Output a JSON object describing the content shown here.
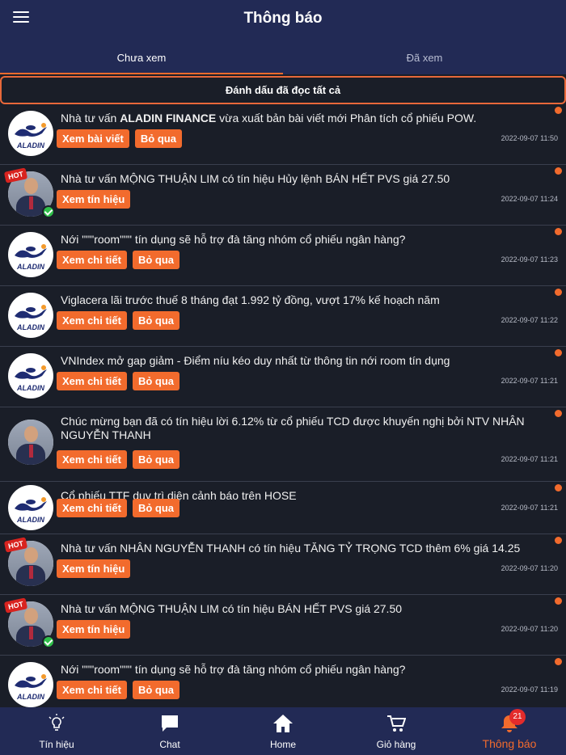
{
  "header": {
    "title": "Thông báo"
  },
  "tabs": [
    {
      "label": "Chưa xem"
    },
    {
      "label": "Đã xem"
    }
  ],
  "mark_all_read": "Đánh dấu đã đọc tất cả",
  "notifications": [
    {
      "prefix": "Nhà tư vấn ",
      "bold": "ALADIN FINANCE",
      "suffix": " vừa xuất bản bài viết mới Phân tích cổ phiếu POW.",
      "actions": [
        "Xem bài viết",
        "Bỏ qua"
      ],
      "time": "2022-09-07 11:50",
      "avatar": "aladin-logo"
    },
    {
      "text": "Nhà tư vấn MỘNG THUẬN LIM có tín hiệu Hủy lệnh BÁN HẾT PVS giá 27.50",
      "actions": [
        "Xem tín hiệu"
      ],
      "time": "2022-09-07 11:24",
      "avatar": "person",
      "hot": "HOT"
    },
    {
      "text": "Nới \"\"\"room\"\"\" tín dụng sẽ hỗ trợ đà tăng nhóm cổ phiếu ngân hàng?",
      "actions": [
        "Xem chi tiết",
        "Bỏ qua"
      ],
      "time": "2022-09-07 11:23",
      "avatar": "aladin-logo"
    },
    {
      "text": "Viglacera lãi trước thuế 8 tháng đạt 1.992 tỷ đồng, vượt 17% kế hoạch năm",
      "actions": [
        "Xem chi tiết",
        "Bỏ qua"
      ],
      "time": "2022-09-07 11:22",
      "avatar": "aladin-logo"
    },
    {
      "text": "VNIndex mở gap giảm - Điểm níu kéo duy nhất từ thông tin nới room tín dụng",
      "actions": [
        "Xem chi tiết",
        "Bỏ qua"
      ],
      "time": "2022-09-07 11:21",
      "avatar": "aladin-logo"
    },
    {
      "text": "Chúc mừng bạn đã có tín hiệu lời 6.12% từ cổ phiếu TCD được khuyến nghị bởi NTV NHÂN NGUYỄN THANH",
      "actions": [
        "Xem chi tiết",
        "Bỏ qua"
      ],
      "time": "2022-09-07 11:21",
      "avatar": "person"
    },
    {
      "text": "Cổ phiếu TTF duy trì diện cảnh báo trên HOSE",
      "actions": [
        "Xem chi tiết",
        "Bỏ qua"
      ],
      "time": "2022-09-07 11:21",
      "avatar": "aladin-logo"
    },
    {
      "text": "Nhà tư vấn NHÂN NGUYỄN THANH có tín hiệu TĂNG TỶ TRỌNG TCD thêm 6% giá 14.25",
      "actions": [
        "Xem tín hiệu"
      ],
      "time": "2022-09-07 11:20",
      "avatar": "person",
      "hot": "HOT"
    },
    {
      "text": "Nhà tư vấn MỘNG THUẬN LIM có tín hiệu BÁN HẾT PVS giá 27.50",
      "actions": [
        "Xem tín hiệu"
      ],
      "time": "2022-09-07 11:20",
      "avatar": "person",
      "hot": "HOT"
    },
    {
      "text": "Nới \"\"\"room\"\"\" tín dụng sẽ hỗ trợ đà tăng nhóm cổ phiếu ngân hàng?",
      "actions": [
        "Xem chi tiết",
        "Bỏ qua"
      ],
      "time": "2022-09-07 11:19",
      "avatar": "aladin-logo"
    }
  ],
  "aladin_logo_text": "ALADIN",
  "bottom_nav": [
    {
      "label": "Tín hiệu",
      "icon": "lightbulb-icon"
    },
    {
      "label": "Chat",
      "icon": "chat-icon"
    },
    {
      "label": "Home",
      "icon": "home-icon"
    },
    {
      "label": "Giỏ hàng",
      "icon": "cart-icon"
    },
    {
      "label": "Thông báo",
      "icon": "bell-icon",
      "badge": "21"
    }
  ],
  "colors": {
    "accent": "#f26b2d",
    "header": "#222a55",
    "background": "#1a1e28",
    "badge": "#e32b2b"
  }
}
